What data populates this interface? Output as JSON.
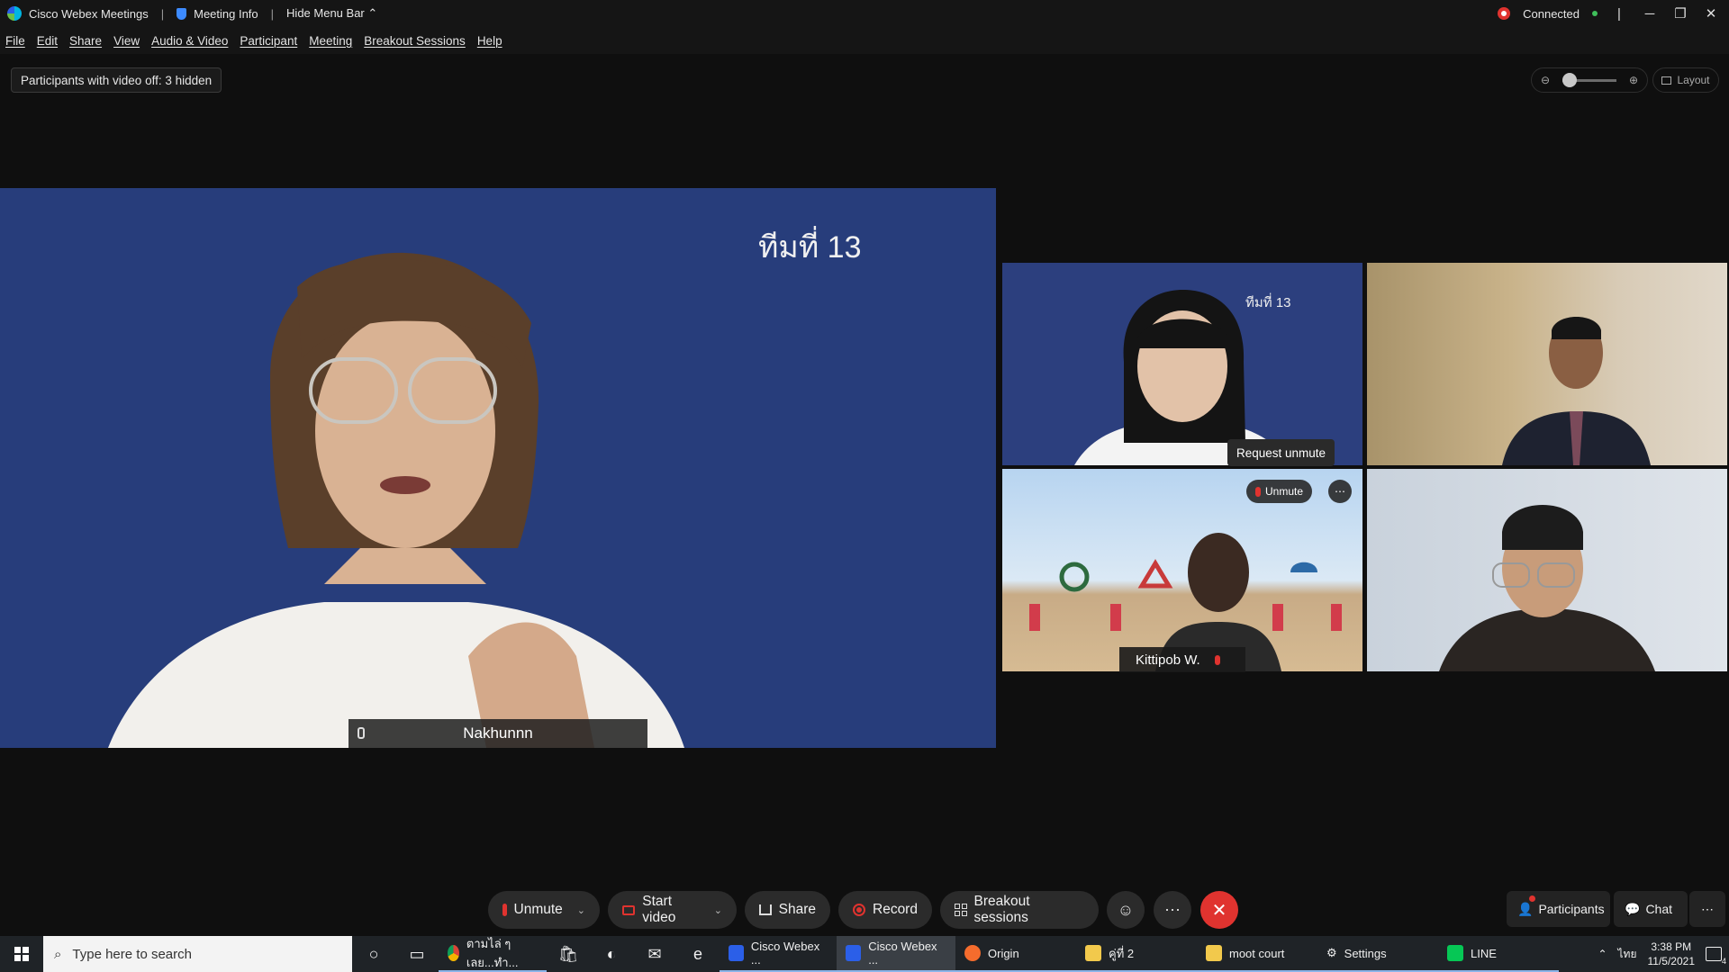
{
  "titlebar": {
    "app_name": "Cisco Webex Meetings",
    "meeting_info": "Meeting Info",
    "hide_menu": "Hide Menu Bar",
    "status": "Connected"
  },
  "menu": [
    "File",
    "Edit",
    "Share",
    "View",
    "Audio & Video",
    "Participant",
    "Meeting",
    "Breakout Sessions",
    "Help"
  ],
  "toolbar": {
    "hidden_info": "Participants with video off: 3 hidden",
    "layout": "Layout"
  },
  "main_stage": {
    "caption": "ทีมที่ 13",
    "speaker_name": "Nakhunnn"
  },
  "tiles": {
    "t1_caption": "ทีมที่ 13",
    "tooltip": "Request unmute",
    "unmute": "Unmute",
    "t3_name": "Kittipob W."
  },
  "controls": {
    "unmute": "Unmute",
    "start_video": "Start video",
    "share": "Share",
    "record": "Record",
    "breakout": "Breakout sessions",
    "participants": "Participants",
    "chat": "Chat"
  },
  "taskbar": {
    "search_placeholder": "Type here to search",
    "tasks": [
      "ตามไล่ ๆ เลย...ทำ...",
      "Cisco Webex ...",
      "Cisco Webex ...",
      "Origin",
      "คู่ที่ 2",
      "moot court",
      "Settings",
      "LINE"
    ],
    "lang": "ไทย",
    "time": "3:38 PM",
    "date": "11/5/2021",
    "notifications": "4"
  },
  "colors": {
    "accent_red": "#e0332f",
    "stage_blue": "#273d7b",
    "panel": "#2b2b2b"
  }
}
